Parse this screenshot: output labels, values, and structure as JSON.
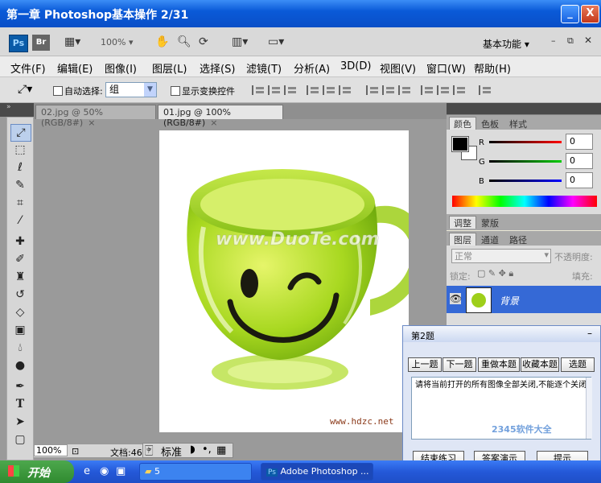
{
  "window": {
    "title": "第一章 Photoshop基本操作  2/31",
    "minimize": "_",
    "close": "X"
  },
  "appbar": {
    "ps_icon": "Ps",
    "br_icon": "Br",
    "zoom": "100%",
    "workspace": "基本功能"
  },
  "menubar": [
    "文件(F)",
    "编辑(E)",
    "图像(I)",
    "图层(L)",
    "选择(S)",
    "滤镜(T)",
    "分析(A)",
    "3D(D)",
    "视图(V)",
    "窗口(W)",
    "帮助(H)"
  ],
  "options": {
    "auto_select_label": "自动选择:",
    "auto_select_value": "组",
    "show_transform_label": "显示变换控件"
  },
  "documents": {
    "tabs": [
      {
        "label": "02.jpg @ 50%(RGB/8#)",
        "close": "×"
      },
      {
        "label": "01.jpg @ 100%(RGB/8#)",
        "close": "×"
      }
    ],
    "watermark": "www.DuoTe.com",
    "image_credit": "www.hdzc.net"
  },
  "statusbar": {
    "zoom": "100%",
    "doc_info": "文档:46",
    "input_mode": "标准"
  },
  "color_panel": {
    "tabs": [
      "颜色",
      "色板",
      "样式"
    ],
    "r_label": "R",
    "g_label": "G",
    "b_label": "B",
    "r": "0",
    "g": "0",
    "b": "0"
  },
  "adjust_panel": {
    "tabs": [
      "调整",
      "蒙版"
    ]
  },
  "layers_panel": {
    "tabs": [
      "图层",
      "通道",
      "路径"
    ],
    "blend_mode": "正常",
    "opacity_label": "不透明度:",
    "lock_label": "锁定:",
    "fill_label": "填充:",
    "layer_name": "背景"
  },
  "quiz": {
    "title": "第2题",
    "prev": "上一题",
    "next": "下一题",
    "redo": "重做本题",
    "favorite": "收藏本题",
    "select": "选题",
    "question": "请将当前打开的所有图像全部关闭,不能逐个关闭",
    "finish": "结束练习",
    "demo": "答案演示",
    "hint": "提示",
    "source_watermark": "2345软件大全"
  },
  "taskbar": {
    "start": "开始",
    "folder": "5",
    "app": "Adobe Photoshop ..."
  }
}
